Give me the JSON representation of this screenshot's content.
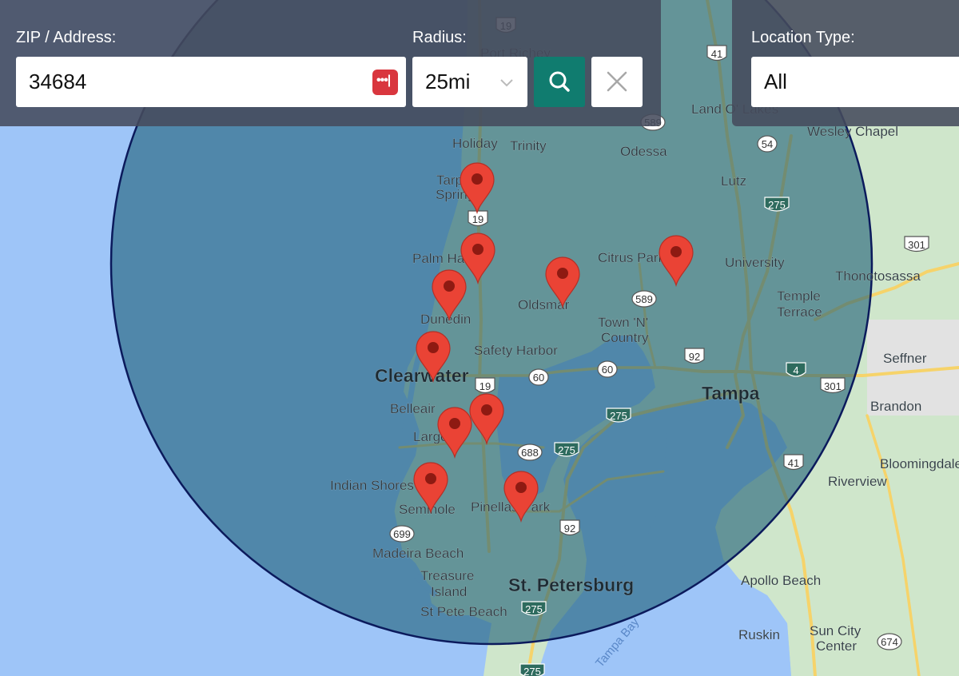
{
  "form": {
    "address_label": "ZIP / Address:",
    "address_value": "34684",
    "radius_label": "Radius:",
    "radius_value": "25mi",
    "location_type_label": "Location Type:",
    "location_type_value": "All"
  },
  "map": {
    "places": [
      {
        "name": "Port Richey",
        "cls": "town"
      },
      {
        "name": "Holiday",
        "cls": "town"
      },
      {
        "name": "Trinity",
        "cls": "town"
      },
      {
        "name": "Land O' Lakes",
        "cls": "town"
      },
      {
        "name": "Wesley Chapel",
        "cls": "town"
      },
      {
        "name": "Odessa",
        "cls": "town"
      },
      {
        "name": "Lutz",
        "cls": "town"
      },
      {
        "name": "Tarpon",
        "cls": "town"
      },
      {
        "name": "Springs",
        "cls": "town"
      },
      {
        "name": "Palm Harbor",
        "cls": "town"
      },
      {
        "name": "Citrus Park",
        "cls": "town"
      },
      {
        "name": "University",
        "cls": "town"
      },
      {
        "name": "Thonotosassa",
        "cls": "town"
      },
      {
        "name": "Oldsmar",
        "cls": "town"
      },
      {
        "name": "Temple",
        "cls": "town"
      },
      {
        "name": "Terrace",
        "cls": "town"
      },
      {
        "name": "Dunedin",
        "cls": "town"
      },
      {
        "name": "Town 'N'",
        "cls": "town"
      },
      {
        "name": "Country",
        "cls": "town"
      },
      {
        "name": "Safety Harbor",
        "cls": "town"
      },
      {
        "name": "Seffner",
        "cls": "town"
      },
      {
        "name": "Clearwater",
        "cls": "city"
      },
      {
        "name": "Tampa",
        "cls": "city"
      },
      {
        "name": "Belleair",
        "cls": "town"
      },
      {
        "name": "Brandon",
        "cls": "town"
      },
      {
        "name": "Largo",
        "cls": "town"
      },
      {
        "name": "Bloomingdale",
        "cls": "town"
      },
      {
        "name": "Indian Shores",
        "cls": "town"
      },
      {
        "name": "Riverview",
        "cls": "town"
      },
      {
        "name": "Seminole",
        "cls": "town"
      },
      {
        "name": "Pinellas Park",
        "cls": "town"
      },
      {
        "name": "Madeira Beach",
        "cls": "town"
      },
      {
        "name": "Treasure",
        "cls": "town"
      },
      {
        "name": "Island",
        "cls": "town"
      },
      {
        "name": "St. Petersburg",
        "cls": "city"
      },
      {
        "name": "St Pete Beach",
        "cls": "town"
      },
      {
        "name": "Apollo Beach",
        "cls": "town"
      },
      {
        "name": "Ruskin",
        "cls": "town"
      },
      {
        "name": "Sun City",
        "cls": "town"
      },
      {
        "name": "Center",
        "cls": "town"
      },
      {
        "name": "Tampa Bay",
        "cls": "water"
      }
    ],
    "shields": [
      {
        "num": "19",
        "type": "us"
      },
      {
        "num": "41",
        "type": "us"
      },
      {
        "num": "589",
        "type": "state"
      },
      {
        "num": "54",
        "type": "state"
      },
      {
        "num": "275",
        "type": "interstate"
      },
      {
        "num": "301",
        "type": "us"
      },
      {
        "num": "19",
        "type": "us"
      },
      {
        "num": "589",
        "type": "state"
      },
      {
        "num": "92",
        "type": "us"
      },
      {
        "num": "60",
        "type": "state"
      },
      {
        "num": "60",
        "type": "state"
      },
      {
        "num": "19",
        "type": "us"
      },
      {
        "num": "4",
        "type": "interstate"
      },
      {
        "num": "301",
        "type": "us"
      },
      {
        "num": "275",
        "type": "interstate"
      },
      {
        "num": "688",
        "type": "state"
      },
      {
        "num": "275",
        "type": "interstate"
      },
      {
        "num": "41",
        "type": "us"
      },
      {
        "num": "92",
        "type": "us"
      },
      {
        "num": "699",
        "type": "state"
      },
      {
        "num": "275",
        "type": "interstate"
      },
      {
        "num": "275",
        "type": "interstate"
      },
      {
        "num": "674",
        "type": "state"
      }
    ],
    "markers": [
      "marker",
      "marker",
      "marker",
      "marker",
      "marker",
      "marker",
      "marker",
      "marker",
      "marker",
      "marker"
    ],
    "colors": {
      "water": "#9ec5f8",
      "land": "#cfe6cb",
      "radius_fill": "#1c5d77",
      "radius_stroke": "#0b1a5c",
      "marker": "#ea4335",
      "panel": "#464b5c",
      "search_button": "#107c6f"
    }
  }
}
